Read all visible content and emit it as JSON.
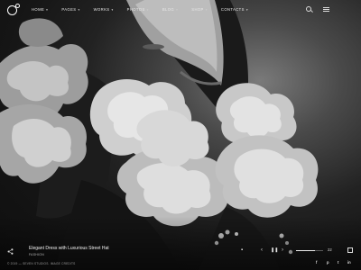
{
  "nav": {
    "items": [
      {
        "label": "HOME"
      },
      {
        "label": "PAGES"
      },
      {
        "label": "WORKS"
      },
      {
        "label": "PHOTOS"
      },
      {
        "label": "BLOG"
      },
      {
        "label": "SHOP"
      },
      {
        "label": "CONTACTS"
      }
    ]
  },
  "caption": {
    "title": "Elegant Dress with Luxurious Street Hat",
    "subtitle": "FASHION"
  },
  "slider": {
    "progress": 0.7,
    "counter": "22"
  },
  "footer": {
    "copyright": "© 2019 — SEVEN STUDIOS. IMAGE CREDITS",
    "social": [
      "f",
      "p",
      "t",
      "in"
    ]
  },
  "icons": {
    "logo": "circle-logo-icon",
    "search": "search-icon",
    "menu": "hamburger-menu-icon",
    "share": "share-icon",
    "prev": "chevron-left-icon",
    "pause": "pause-icon",
    "next": "chevron-right-icon",
    "fullscreen": "fullscreen-icon"
  }
}
